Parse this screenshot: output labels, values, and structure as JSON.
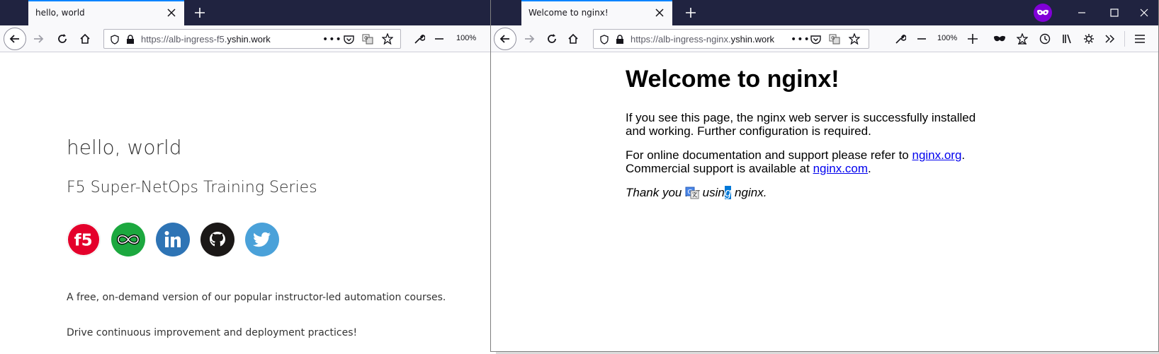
{
  "left_window": {
    "tab": {
      "title": "hello, world"
    },
    "url": {
      "prefix": "https://alb-ingress-f5.",
      "domain": "yshin.work"
    },
    "zoom": "100%",
    "page": {
      "title": "hello, world",
      "subtitle": "F5 Super-NetOps Training Series",
      "f5_logo_text": "f5",
      "paragraph1": "A free, on-demand version of our popular instructor-led automation courses.",
      "paragraph2": "Drive continuous improvement and deployment practices!"
    },
    "social_icons": [
      "f5-icon",
      "infinity-icon",
      "linkedin-icon",
      "github-icon",
      "twitter-icon"
    ]
  },
  "right_window": {
    "tab": {
      "title": "Welcome to nginx!"
    },
    "url": {
      "prefix": "https://alb-ingress-nginx.",
      "domain": "yshin.work"
    },
    "zoom": "100%",
    "page": {
      "heading": "Welcome to nginx!",
      "p1": "If you see this page, the nginx web server is successfully installed and working. Further configuration is required.",
      "p2_text1": "For online documentation and support please refer to ",
      "p2_link1": "nginx.org",
      "p2_text2": ".",
      "p2_text3": "Commercial support is available at ",
      "p2_link2": "nginx.com",
      "p2_text4": ".",
      "p3_text1": "Thank you for usin",
      "p3_highlight": "g",
      "p3_text2": " nginx."
    }
  },
  "colors": {
    "tabstrip": "#202340",
    "accent": "#0a84ff",
    "private_badge": "#8000d7"
  }
}
